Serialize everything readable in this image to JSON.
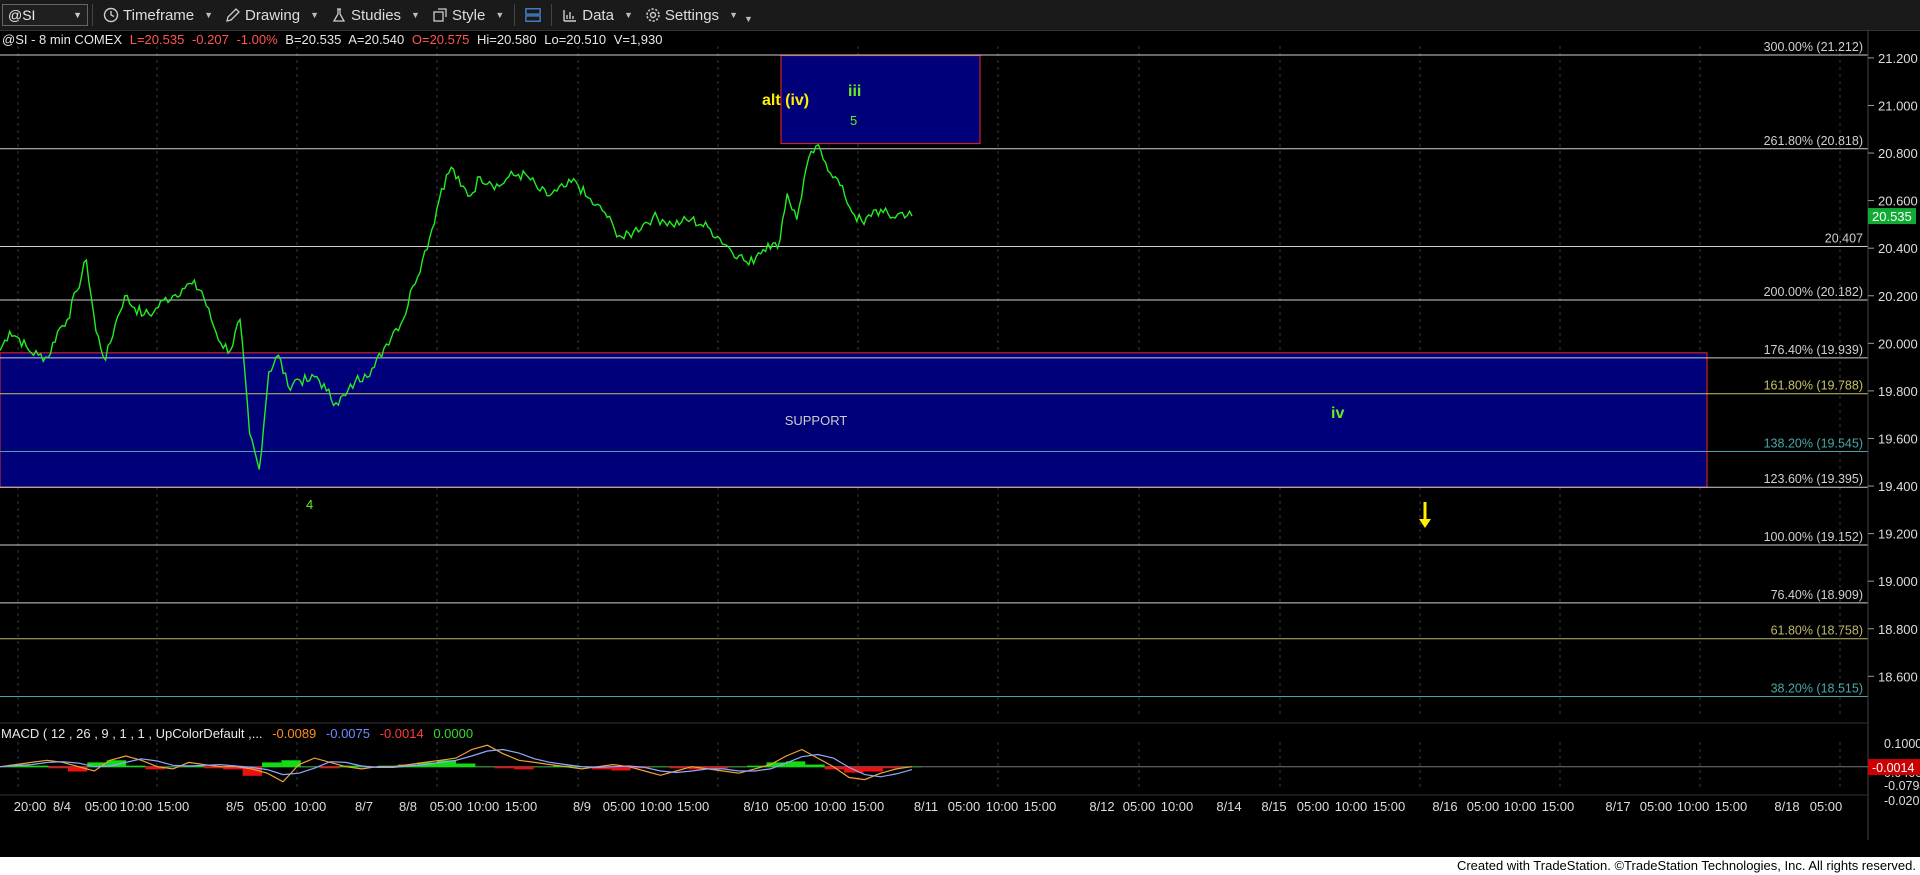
{
  "toolbar": {
    "symbol": "@SI",
    "timeframe_label": "Timeframe",
    "drawing_label": "Drawing",
    "studies_label": "Studies",
    "style_label": "Style",
    "data_label": "Data",
    "settings_label": "Settings",
    "icons": [
      "clock-icon",
      "pencil-icon",
      "studies-icon",
      "style-icon",
      "layout-icon",
      "data-icon",
      "gear-icon"
    ]
  },
  "header": {
    "symbol_info": "@SI - 8 min  COMEX",
    "last": "L=20.535",
    "change": "-0.207",
    "change_pct": "-1.00%",
    "bid": "B=20.535",
    "ask": "A=20.540",
    "open": "O=20.575",
    "high": "Hi=20.580",
    "low": "Lo=20.510",
    "volume": "V=1,930"
  },
  "colors": {
    "price_line": "#22ee22",
    "zone_fill": "#00007a",
    "zone_border": "#cc2222",
    "level_line": "#cfcfcf",
    "wave_label_yellow": "#ffee00",
    "wave_label_green": "#66ee22",
    "last_price_marker": "#11aa33",
    "macd_marker": "#cc0000"
  },
  "chart_data": {
    "type": "line",
    "series": [
      {
        "values": [
          19.97,
          20.05,
          20.02,
          19.97,
          19.95,
          19.94,
          20.05,
          20.1,
          20.22,
          20.35,
          20.05,
          19.93,
          20.08,
          20.2,
          20.15,
          20.12,
          20.13,
          20.18,
          20.2,
          20.23,
          20.25,
          20.22,
          20.1,
          20.0,
          19.97,
          20.1,
          19.62,
          19.47,
          19.88,
          19.95,
          19.82,
          19.85,
          19.84,
          19.86,
          19.8,
          19.75,
          19.78,
          19.84,
          19.87,
          19.9,
          19.98,
          20.05,
          20.1,
          20.24,
          20.35,
          20.48,
          20.65,
          20.74,
          20.66,
          20.62,
          20.7,
          20.68,
          20.66,
          20.7,
          20.71,
          20.7,
          20.65,
          20.62,
          20.64,
          20.66,
          20.68,
          20.62,
          20.58,
          20.55,
          20.48,
          20.44,
          20.47,
          20.5,
          20.53,
          20.52,
          20.5,
          20.51,
          20.52,
          20.5,
          20.48,
          20.44,
          20.4,
          20.37,
          20.33,
          20.38,
          20.42,
          20.4,
          20.63,
          20.52,
          20.74,
          20.83,
          20.76,
          20.7,
          20.62,
          20.54,
          20.5,
          20.56,
          20.55,
          20.53,
          20.55,
          20.535
        ]
      }
    ],
    "price_axis": {
      "ticks": [
        "21.200",
        "21.000",
        "20.800",
        "20.600",
        "20.400",
        "20.200",
        "20.000",
        "19.800",
        "19.600",
        "19.400",
        "19.200",
        "19.000",
        "18.800",
        "18.600"
      ],
      "range": [
        18.45,
        21.25
      ]
    },
    "last_price_label": "20.535",
    "fib_levels": [
      {
        "label": "300.00% (21.212)",
        "value": 21.212
      },
      {
        "label": "261.80% (20.818)",
        "value": 20.818
      },
      {
        "label": "20.407",
        "value": 20.407
      },
      {
        "label": "200.00% (20.182)",
        "value": 20.182
      },
      {
        "label": "176.40% (19.939)",
        "value": 19.939
      },
      {
        "label": "161.80% (19.788)",
        "value": 19.788
      },
      {
        "label": "138.20% (19.545)",
        "value": 19.545
      },
      {
        "label": "123.60% (19.395)",
        "value": 19.395
      },
      {
        "label": "100.00% (19.152)",
        "value": 19.152
      },
      {
        "label": "76.40% (18.909)",
        "value": 18.909
      },
      {
        "label": "61.80% (18.758)",
        "value": 18.758
      },
      {
        "label": "38.20% (18.515)",
        "value": 18.515
      }
    ],
    "zones": [
      {
        "name": "support-zone",
        "label": "SUPPORT",
        "low": 19.395,
        "high": 19.96
      },
      {
        "name": "target-zone",
        "label": "",
        "low": 20.84,
        "high": 21.21
      }
    ],
    "wave_labels": [
      {
        "text": "alt (iv)",
        "color": "yellow"
      },
      {
        "text": "iii",
        "color": "green"
      },
      {
        "text": "5",
        "color": "green"
      },
      {
        "text": "4",
        "color": "green"
      },
      {
        "text": "iv",
        "color": "green"
      }
    ],
    "macd": {
      "label": "MACD ( 12 , 26 , 9 , 1 , 1 , UpColorDefault ,...",
      "values": [
        "-0.0089",
        "-0.0075",
        "-0.0014",
        "0.0000"
      ],
      "axis_ticks": [
        "0.1000",
        "0.0400",
        "-0.0200",
        "-0.0794"
      ],
      "current": "-0.0014",
      "macd_line": [
        0,
        0.01,
        0.02,
        0.03,
        0.02,
        0.0,
        -0.02,
        0.03,
        0.05,
        0.03,
        0.0,
        -0.01,
        0.02,
        0.01,
        0.0,
        0.0,
        -0.01,
        -0.03,
        -0.07,
        0.01,
        0.04,
        0.02,
        0.0,
        -0.01,
        0.0,
        0.0,
        0.01,
        0.02,
        0.03,
        0.04,
        0.08,
        0.1,
        0.06,
        0.03,
        0.02,
        0.01,
        0.0,
        -0.01,
        0.0,
        0.01,
        0.0,
        -0.02,
        -0.04,
        -0.02,
        0.0,
        -0.01,
        -0.02,
        -0.03,
        -0.01,
        0.01,
        0.05,
        0.08,
        0.04,
        0.0,
        -0.05,
        -0.06,
        -0.03,
        -0.01,
        0.0
      ],
      "hist": [
        0,
        0.01,
        0.005,
        -0.005,
        -0.02,
        0.02,
        0.03,
        0.005,
        -0.01,
        0.0,
        0.005,
        -0.005,
        -0.01,
        -0.04,
        0.02,
        0.03,
        0.0,
        -0.005,
        0.005,
        0.0,
        0.005,
        0.01,
        0.02,
        0.03,
        0.015,
        0.0,
        -0.005,
        -0.01,
        0.0,
        0.005,
        0.0,
        -0.01,
        -0.015,
        -0.005,
        0.0,
        -0.005,
        -0.01,
        -0.005,
        0.0,
        0.005,
        0.02,
        0.025,
        0.01,
        -0.01,
        -0.025,
        -0.02,
        -0.005,
        0.0
      ]
    },
    "x_ticks": [
      "20:00",
      "8/4",
      "05:00",
      "10:00",
      "15:00",
      "8/5",
      "05:00",
      "10:00",
      "8/7",
      "8/8",
      "05:00",
      "10:00",
      "15:00",
      "8/9",
      "05:00",
      "10:00",
      "15:00",
      "8/10",
      "05:00",
      "10:00",
      "15:00",
      "8/11",
      "05:00",
      "10:00",
      "15:00",
      "8/12",
      "05:00",
      "10:00",
      "8/14",
      "8/15",
      "05:00",
      "10:00",
      "15:00",
      "8/16",
      "05:00",
      "10:00",
      "15:00",
      "8/17",
      "05:00",
      "10:00",
      "15:00",
      "8/18",
      "05:00"
    ]
  },
  "footer": {
    "text": "Created with TradeStation. ©TradeStation Technologies, Inc. All rights reserved."
  }
}
